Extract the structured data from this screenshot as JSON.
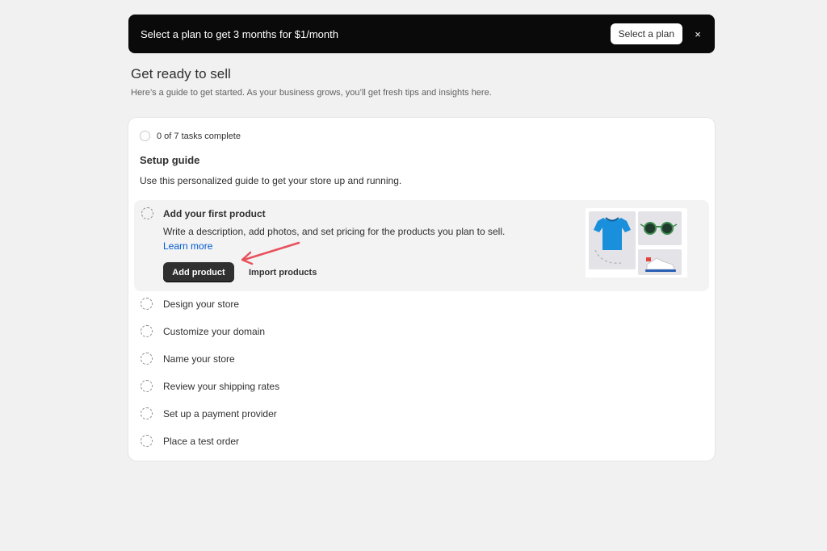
{
  "banner": {
    "text": "Select a plan to get 3 months for $1/month",
    "button_label": "Select a plan",
    "close_glyph": "×"
  },
  "header": {
    "title": "Get ready to sell",
    "subtitle": "Here’s a guide to get started. As your business grows, you’ll get fresh tips and insights here."
  },
  "setup": {
    "progress": "0 of 7 tasks complete",
    "tasks_completed": 0,
    "tasks_total": 7,
    "title": "Setup guide",
    "description": "Use this personalized guide to get your store up and running.",
    "active_task": {
      "title": "Add your first product",
      "description": "Write a description, add photos, and set pricing for the products you plan to sell.",
      "link": "Learn more",
      "primary_button": "Add product",
      "secondary_button": "Import products",
      "illustration": "product-illustration"
    },
    "tasks": [
      "Design your store",
      "Customize your domain",
      "Name your store",
      "Review your shipping rates",
      "Set up a payment provider",
      "Place a test order"
    ]
  },
  "colors": {
    "banner_bg": "#0a0a0a",
    "primary_button_bg": "#303030",
    "link": "#005bd3",
    "annotation_arrow": "#e8505b"
  }
}
